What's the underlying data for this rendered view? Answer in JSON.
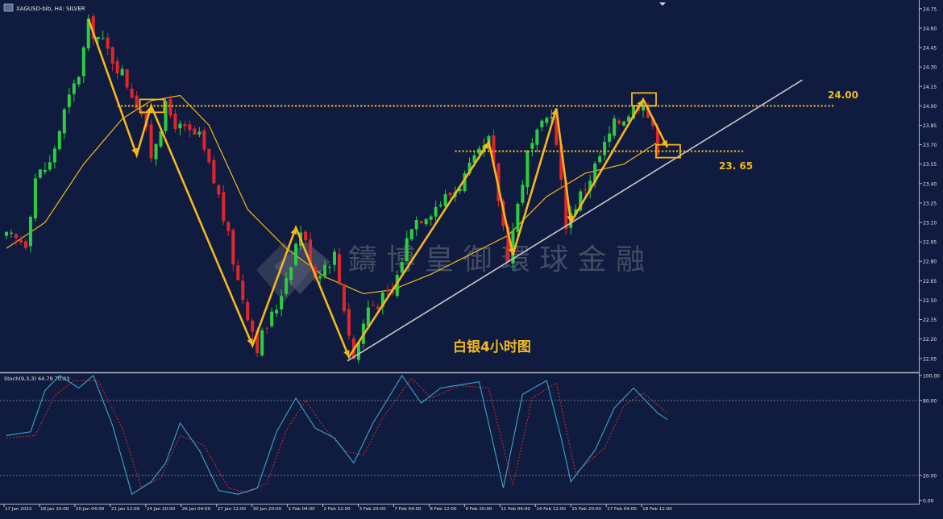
{
  "header": {
    "symbol_info": "XAGUSD-bib, H4:  SILVER"
  },
  "watermark": {
    "text": "鑄  博  皇  御  環  球  金  融"
  },
  "annotations": {
    "chart_title": "白银4小时图",
    "resistance_label": "24.00",
    "support_label": "23. 65"
  },
  "indicator": {
    "label": "Stoch(9,3,3) 64.79 70.03"
  },
  "colors": {
    "background": "#0f1c3f",
    "bull_candle": "#2ecc40",
    "bear_candle": "#e0262b",
    "moving_average": "#f5b81c",
    "swing_lines": "#f5b81c",
    "trendline": "#c8c8c8",
    "stoch_main": "#3aa6c9",
    "stoch_signal": "#e0262b"
  },
  "chart_data": [
    {
      "type": "candlestick",
      "symbol": "XAGUSD-bib",
      "timeframe": "H4",
      "y_tick_labels": [
        "24.75",
        "24.60",
        "24.45",
        "24.30",
        "24.15",
        "24.00",
        "23.85",
        "23.70",
        "23.55",
        "23.40",
        "23.25",
        "23.10",
        "22.95",
        "22.80",
        "22.65",
        "22.50",
        "22.35",
        "22.20",
        "22.05"
      ],
      "ylim": [
        21.98,
        24.78
      ],
      "x_tick_labels": [
        "17 Jan 2022",
        "18 Jan 20:00",
        "20 Jan 04:00",
        "21 Jan 12:00",
        "24 Jan 20:00",
        "26 Jan 04:00",
        "27 Jan 12:00",
        "30 Jan 20:00",
        "1 Feb 04:00",
        "2 Feb 12:00",
        "3 Feb 20:00",
        "7 Feb 04:00",
        "8 Feb 12:00",
        "9 Feb 20:00",
        "11 Feb 04:00",
        "14 Feb 12:00",
        "15 Feb 20:00",
        "17 Feb 04:00",
        "18 Feb 12:00"
      ],
      "approx_close_path": [
        {
          "bar": 0,
          "price": 22.98
        },
        {
          "bar": 4,
          "price": 22.95
        },
        {
          "bar": 6,
          "price": 23.45
        },
        {
          "bar": 9,
          "price": 23.55
        },
        {
          "bar": 12,
          "price": 23.95
        },
        {
          "bar": 15,
          "price": 24.25
        },
        {
          "bar": 17,
          "price": 24.62
        },
        {
          "bar": 20,
          "price": 24.48
        },
        {
          "bar": 24,
          "price": 24.25
        },
        {
          "bar": 28,
          "price": 23.95
        },
        {
          "bar": 30,
          "price": 23.62
        },
        {
          "bar": 33,
          "price": 23.98
        },
        {
          "bar": 36,
          "price": 23.82
        },
        {
          "bar": 40,
          "price": 23.75
        },
        {
          "bar": 44,
          "price": 23.3
        },
        {
          "bar": 48,
          "price": 22.65
        },
        {
          "bar": 52,
          "price": 22.15
        },
        {
          "bar": 56,
          "price": 22.45
        },
        {
          "bar": 61,
          "price": 23.05
        },
        {
          "bar": 64,
          "price": 22.7
        },
        {
          "bar": 68,
          "price": 22.85
        },
        {
          "bar": 72,
          "price": 22.05
        },
        {
          "bar": 75,
          "price": 22.45
        },
        {
          "bar": 80,
          "price": 22.55
        },
        {
          "bar": 84,
          "price": 23.1
        },
        {
          "bar": 88,
          "price": 23.2
        },
        {
          "bar": 93,
          "price": 23.35
        },
        {
          "bar": 100,
          "price": 23.72
        },
        {
          "bar": 104,
          "price": 22.85
        },
        {
          "bar": 108,
          "price": 23.62
        },
        {
          "bar": 113,
          "price": 23.97
        },
        {
          "bar": 116,
          "price": 23.1
        },
        {
          "bar": 121,
          "price": 23.45
        },
        {
          "bar": 126,
          "price": 23.85
        },
        {
          "bar": 132,
          "price": 24.05
        },
        {
          "bar": 135,
          "price": 23.68
        }
      ],
      "moving_average_path": [
        {
          "bar": 0,
          "price": 22.9
        },
        {
          "bar": 8,
          "price": 23.1
        },
        {
          "bar": 16,
          "price": 23.55
        },
        {
          "bar": 24,
          "price": 23.9
        },
        {
          "bar": 30,
          "price": 24.04
        },
        {
          "bar": 36,
          "price": 24.08
        },
        {
          "bar": 42,
          "price": 23.85
        },
        {
          "bar": 50,
          "price": 23.2
        },
        {
          "bar": 58,
          "price": 22.9
        },
        {
          "bar": 66,
          "price": 22.68
        },
        {
          "bar": 74,
          "price": 22.55
        },
        {
          "bar": 80,
          "price": 22.58
        },
        {
          "bar": 88,
          "price": 22.7
        },
        {
          "bar": 96,
          "price": 22.85
        },
        {
          "bar": 104,
          "price": 23.0
        },
        {
          "bar": 112,
          "price": 23.3
        },
        {
          "bar": 120,
          "price": 23.48
        },
        {
          "bar": 128,
          "price": 23.55
        },
        {
          "bar": 135,
          "price": 23.72
        }
      ],
      "horizontal_levels": [
        24.0,
        23.65
      ],
      "swing_pattern": [
        {
          "bar": 17,
          "price": 24.67
        },
        {
          "bar": 27,
          "price": 23.62
        },
        {
          "bar": 30,
          "price": 24.0
        },
        {
          "bar": 51,
          "price": 22.15
        },
        {
          "bar": 60,
          "price": 23.06
        },
        {
          "bar": 71,
          "price": 22.06
        },
        {
          "bar": 100,
          "price": 23.72
        },
        {
          "bar": 105,
          "price": 22.85
        },
        {
          "bar": 114,
          "price": 23.98
        },
        {
          "bar": 117,
          "price": 23.1
        },
        {
          "bar": 132,
          "price": 24.05
        },
        {
          "bar": 137,
          "price": 23.68
        }
      ],
      "trendline": [
        {
          "bar": 71,
          "price": 22.03
        },
        {
          "bar": 163,
          "price": 24.2
        }
      ]
    },
    {
      "type": "line",
      "name": "Stoch(9,3,3)",
      "ylim": [
        0,
        100
      ],
      "y_tick_labels": [
        "100.00",
        "80.00",
        "20.00",
        "0.00"
      ],
      "levels": [
        80,
        20
      ],
      "main_path": [
        {
          "bar": 0,
          "v": 52
        },
        {
          "bar": 5,
          "v": 55
        },
        {
          "bar": 8,
          "v": 88
        },
        {
          "bar": 11,
          "v": 100
        },
        {
          "bar": 15,
          "v": 90
        },
        {
          "bar": 18,
          "v": 100
        },
        {
          "bar": 22,
          "v": 60
        },
        {
          "bar": 26,
          "v": 5
        },
        {
          "bar": 30,
          "v": 15
        },
        {
          "bar": 33,
          "v": 30
        },
        {
          "bar": 36,
          "v": 62
        },
        {
          "bar": 40,
          "v": 40
        },
        {
          "bar": 44,
          "v": 8
        },
        {
          "bar": 48,
          "v": 5
        },
        {
          "bar": 52,
          "v": 10
        },
        {
          "bar": 56,
          "v": 55
        },
        {
          "bar": 60,
          "v": 82
        },
        {
          "bar": 64,
          "v": 58
        },
        {
          "bar": 68,
          "v": 50
        },
        {
          "bar": 72,
          "v": 30
        },
        {
          "bar": 76,
          "v": 62
        },
        {
          "bar": 82,
          "v": 100
        },
        {
          "bar": 86,
          "v": 78
        },
        {
          "bar": 90,
          "v": 90
        },
        {
          "bar": 98,
          "v": 95
        },
        {
          "bar": 103,
          "v": 10
        },
        {
          "bar": 107,
          "v": 85
        },
        {
          "bar": 112,
          "v": 96
        },
        {
          "bar": 115,
          "v": 50
        },
        {
          "bar": 117,
          "v": 15
        },
        {
          "bar": 122,
          "v": 40
        },
        {
          "bar": 126,
          "v": 74
        },
        {
          "bar": 130,
          "v": 90
        },
        {
          "bar": 135,
          "v": 70
        },
        {
          "bar": 137,
          "v": 64.79
        }
      ],
      "signal_path": [
        {
          "bar": 0,
          "v": 50
        },
        {
          "bar": 6,
          "v": 52
        },
        {
          "bar": 10,
          "v": 84
        },
        {
          "bar": 14,
          "v": 96
        },
        {
          "bar": 19,
          "v": 96
        },
        {
          "bar": 24,
          "v": 58
        },
        {
          "bar": 28,
          "v": 10
        },
        {
          "bar": 32,
          "v": 18
        },
        {
          "bar": 36,
          "v": 52
        },
        {
          "bar": 41,
          "v": 44
        },
        {
          "bar": 46,
          "v": 10
        },
        {
          "bar": 50,
          "v": 6
        },
        {
          "bar": 54,
          "v": 14
        },
        {
          "bar": 58,
          "v": 56
        },
        {
          "bar": 62,
          "v": 80
        },
        {
          "bar": 66,
          "v": 58
        },
        {
          "bar": 70,
          "v": 40
        },
        {
          "bar": 74,
          "v": 36
        },
        {
          "bar": 78,
          "v": 66
        },
        {
          "bar": 84,
          "v": 98
        },
        {
          "bar": 88,
          "v": 82
        },
        {
          "bar": 94,
          "v": 92
        },
        {
          "bar": 100,
          "v": 90
        },
        {
          "bar": 105,
          "v": 12
        },
        {
          "bar": 109,
          "v": 82
        },
        {
          "bar": 114,
          "v": 94
        },
        {
          "bar": 118,
          "v": 22
        },
        {
          "bar": 124,
          "v": 42
        },
        {
          "bar": 128,
          "v": 76
        },
        {
          "bar": 132,
          "v": 86
        },
        {
          "bar": 137,
          "v": 70.03
        }
      ]
    }
  ]
}
